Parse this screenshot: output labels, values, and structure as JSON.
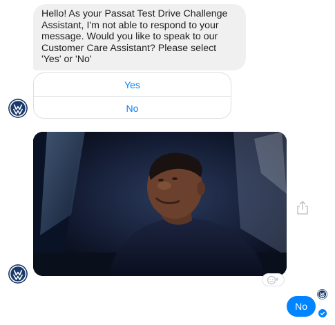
{
  "bot_message": {
    "text": "Hello! As your Passat Test Drive Challenge Assistant, I'm not able to respond to your message. Would you like to speak to our Customer Care Assistant? Please select 'Yes' or 'No'"
  },
  "quick_replies": [
    {
      "label": "Yes"
    },
    {
      "label": "No"
    }
  ],
  "user_message": {
    "text": "No"
  },
  "icons": {
    "avatar": "volkswagen-logo-icon",
    "share": "share-icon",
    "reaction": "add-reaction-icon",
    "read_receipt": "check-icon"
  },
  "colors": {
    "accent": "#0084ff",
    "bot_bubble": "#f1f0f0",
    "vw_blue": "#1a3a6b"
  }
}
